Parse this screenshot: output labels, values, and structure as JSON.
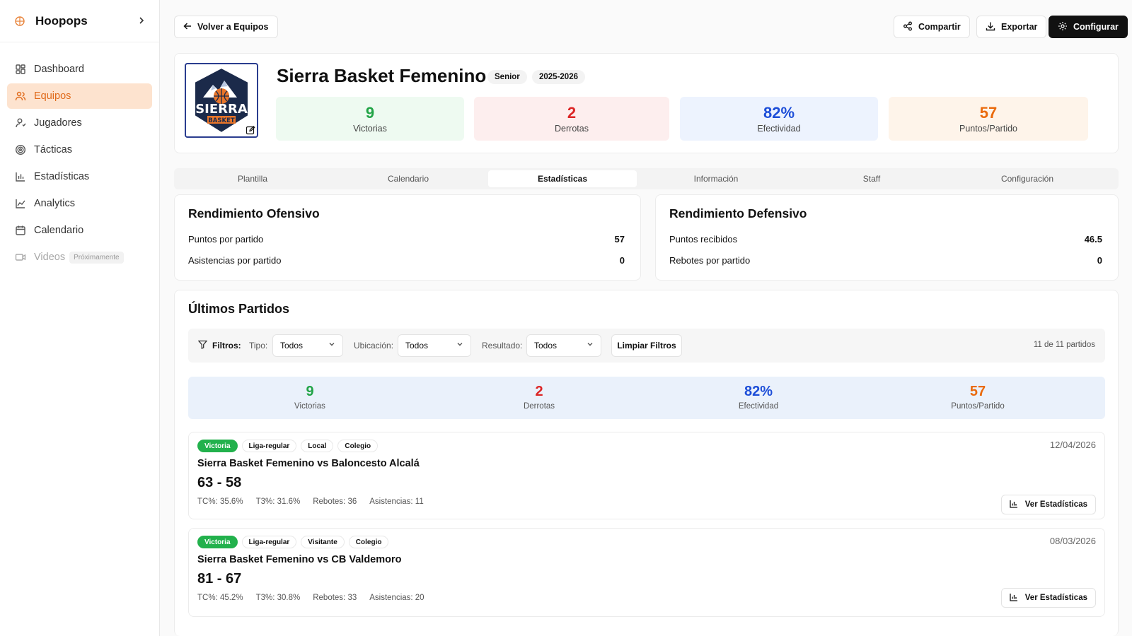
{
  "sidebar": {
    "brand": "Hoopops",
    "items": [
      {
        "label": "Dashboard"
      },
      {
        "label": "Equipos"
      },
      {
        "label": "Jugadores"
      },
      {
        "label": "Tácticas"
      },
      {
        "label": "Estadísticas"
      },
      {
        "label": "Analytics"
      },
      {
        "label": "Calendario"
      },
      {
        "label": "Videos",
        "badge": "Próximamente"
      }
    ]
  },
  "topbar": {
    "back": "Volver a Equipos",
    "share": "Compartir",
    "export": "Exportar",
    "configure": "Configurar"
  },
  "team": {
    "name": "Sierra Basket Femenino",
    "category": "Senior",
    "season": "2025-2026",
    "logo_text_main": "SIERRA",
    "logo_text_sub": "BASKET",
    "stats": [
      {
        "value": "9",
        "label": "Victorias"
      },
      {
        "value": "2",
        "label": "Derrotas"
      },
      {
        "value": "82%",
        "label": "Efectividad"
      },
      {
        "value": "57",
        "label": "Puntos/Partido"
      }
    ]
  },
  "tabs": [
    "Plantilla",
    "Calendario",
    "Estadísticas",
    "Información",
    "Staff",
    "Configuración"
  ],
  "offense": {
    "title": "Rendimiento Ofensivo",
    "rows": [
      {
        "label": "Puntos por partido",
        "value": "57"
      },
      {
        "label": "Asistencias por partido",
        "value": "0"
      }
    ]
  },
  "defense": {
    "title": "Rendimiento Defensivo",
    "rows": [
      {
        "label": "Puntos recibidos",
        "value": "46.5"
      },
      {
        "label": "Rebotes por partido",
        "value": "0"
      }
    ]
  },
  "games": {
    "title": "Últimos Partidos",
    "filters": {
      "label": "Filtros:",
      "type_label": "Tipo:",
      "type_value": "Todos",
      "location_label": "Ubicación:",
      "location_value": "Todos",
      "result_label": "Resultado:",
      "result_value": "Todos",
      "clear": "Limpiar Filtros",
      "count": "11 de 11 partidos"
    },
    "summary": [
      {
        "value": "9",
        "label": "Victorias"
      },
      {
        "value": "2",
        "label": "Derrotas"
      },
      {
        "value": "82%",
        "label": "Efectividad"
      },
      {
        "value": "57",
        "label": "Puntos/Partido"
      }
    ],
    "matches": [
      {
        "tags": [
          "Victoria",
          "Liga-regular",
          "Local",
          "Colegio"
        ],
        "date": "12/04/2026",
        "title": "Sierra Basket Femenino vs Baloncesto Alcalá",
        "score": "63 - 58",
        "stats": [
          "TC%: 35.6%",
          "T3%: 31.6%",
          "Rebotes: 36",
          "Asistencias: 11"
        ],
        "button": "Ver Estadísticas"
      },
      {
        "tags": [
          "Victoria",
          "Liga-regular",
          "Visitante",
          "Colegio"
        ],
        "date": "08/03/2026",
        "title": "Sierra Basket Femenino vs CB Valdemoro",
        "score": "81 - 67",
        "stats": [
          "TC%: 45.2%",
          "T3%: 30.8%",
          "Rebotes: 33",
          "Asistencias: 20"
        ],
        "button": "Ver Estadísticas"
      }
    ]
  },
  "colors": {
    "accent": "#e06a1a",
    "win": "#22a447",
    "loss": "#dc2626",
    "efficiency": "#1d4ed8",
    "points": "#ea6a0c"
  },
  "icons": [
    "basketball-icon",
    "chevron-right-icon",
    "dashboard-icon",
    "users-icon",
    "user-icon",
    "target-icon",
    "bar-chart-icon",
    "line-chart-icon",
    "calendar-icon",
    "video-icon",
    "arrow-left-icon",
    "share-icon",
    "download-icon",
    "gear-icon",
    "edit-icon",
    "filter-icon",
    "chevron-down-icon"
  ]
}
